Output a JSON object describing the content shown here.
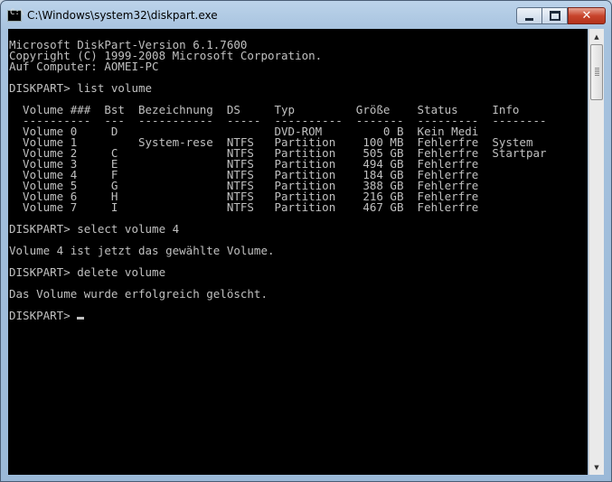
{
  "window": {
    "title": "C:\\Windows\\system32\\diskpart.exe",
    "icon": "console-app-icon",
    "icon_glyph": "C:\\"
  },
  "controls": {
    "close_glyph": "✕",
    "scroll_up_glyph": "▲",
    "scroll_down_glyph": "▼"
  },
  "console": {
    "lines": [
      "Microsoft DiskPart-Version 6.1.7600",
      "Copyright (C) 1999-2008 Microsoft Corporation.",
      "Auf Computer: AOMEI-PC",
      "",
      "DISKPART> list volume",
      "",
      "  Volume ###  Bst  Bezeichnung  DS     Typ         Größe    Status     Info",
      "  ----------  ---  -----------  -----  ----------  -------  ---------  --------",
      "  Volume 0     D                       DVD-ROM         0 B  Kein Medi",
      "  Volume 1         System-rese  NTFS   Partition    100 MB  Fehlerfre  System",
      "  Volume 2     C                NTFS   Partition    505 GB  Fehlerfre  Startpar",
      "  Volume 3     E                NTFS   Partition    494 GB  Fehlerfre",
      "  Volume 4     F                NTFS   Partition    184 GB  Fehlerfre",
      "  Volume 5     G                NTFS   Partition    388 GB  Fehlerfre",
      "  Volume 6     H                NTFS   Partition    216 GB  Fehlerfre",
      "  Volume 7     I                NTFS   Partition    467 GB  Fehlerfre",
      "",
      "DISKPART> select volume 4",
      "",
      "Volume 4 ist jetzt das gewählte Volume.",
      "",
      "DISKPART> delete volume",
      "",
      "Das Volume wurde erfolgreich gelöscht.",
      "",
      "DISKPART> "
    ]
  }
}
